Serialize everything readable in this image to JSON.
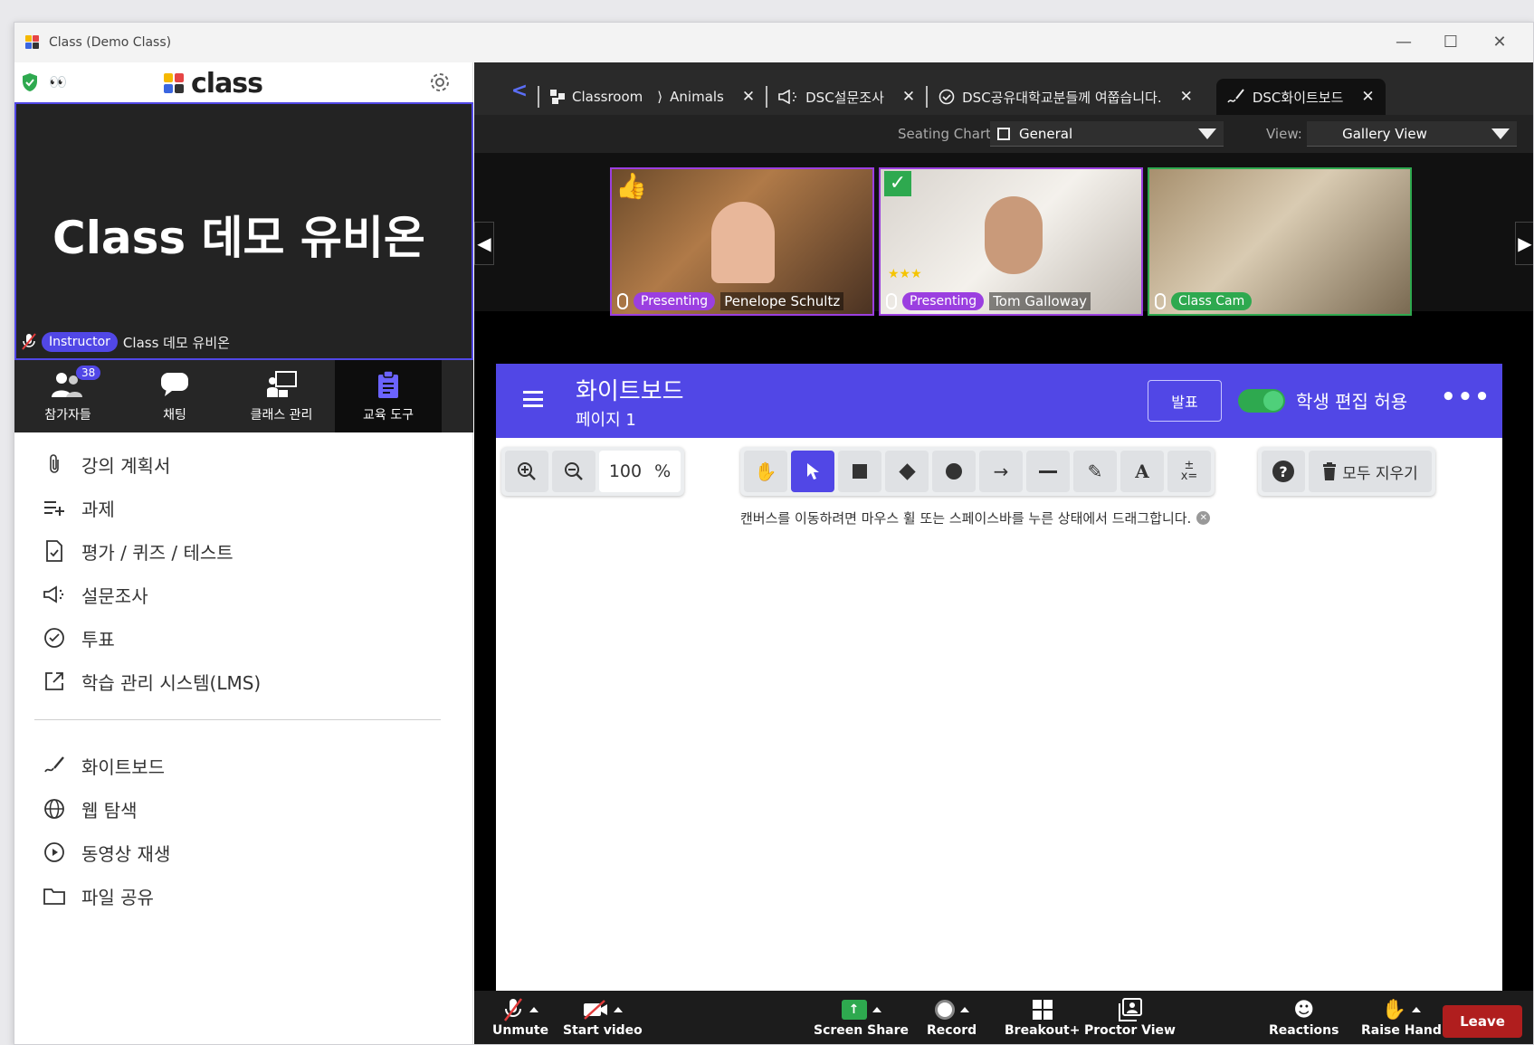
{
  "window": {
    "title": "Class (Demo Class)"
  },
  "brand": {
    "name": "class"
  },
  "main_video": {
    "name": "Class 데모 유비온",
    "role": "Instructor",
    "label_name": "Class 데모 유비온"
  },
  "nav": {
    "participants": {
      "label": "참가자들",
      "badge": "38"
    },
    "chat": {
      "label": "채팅"
    },
    "class_manage": {
      "label": "클래스 관리"
    },
    "edu_tools": {
      "label": "교육 도구"
    }
  },
  "menu": {
    "items": [
      "강의 계획서",
      "과제",
      "평가 / 퀴즈 / 테스트",
      "설문조사",
      "투표",
      "학습 관리 시스템(LMS)"
    ],
    "tools": [
      "화이트보드",
      "웹 탐색",
      "동영상 재생",
      "파일 공유"
    ]
  },
  "tabs": {
    "back": "<",
    "items": [
      {
        "label": "Classroom"
      },
      {
        "label": "Animals"
      },
      {
        "label": "DSC설문조사"
      },
      {
        "label": "DSC공유대학교분들께 여쭙습니다."
      },
      {
        "label": "DSC화이트보드"
      }
    ],
    "close": "✕"
  },
  "seating": {
    "label": "Seating Chart:",
    "value": "General",
    "view_label": "View:",
    "view_value": "Gallery View"
  },
  "gallery": {
    "cams": [
      {
        "status": "Presenting",
        "name": "Penelope Schultz"
      },
      {
        "status": "Presenting",
        "name": "Tom Galloway"
      },
      {
        "name": "Class Cam"
      }
    ]
  },
  "whiteboard": {
    "title": "화이트보드",
    "page": "페이지 1",
    "present_btn": "발표",
    "toggle_label": "학생 편집 허용",
    "more": "•••",
    "zoom": {
      "value": "100",
      "unit": "%"
    },
    "hint": "캔버스를 이동하려면 마우스 휠 또는 스페이스바를 누른 상태에서 드래그합니다.",
    "clear_all": "모두 지우기",
    "help": "?"
  },
  "toolbar": {
    "unmute": "Unmute",
    "start_video": "Start video",
    "screen_share": "Screen Share",
    "record": "Record",
    "breakout": "Breakout+",
    "proctor": "Proctor View",
    "reactions": "Reactions",
    "raise_hand": "Raise Hand",
    "leave": "Leave"
  },
  "colors": {
    "accent": "#5147e6",
    "present": "#9b3fe0",
    "leave": "#b01e1e",
    "toggle": "#2ea94f"
  }
}
